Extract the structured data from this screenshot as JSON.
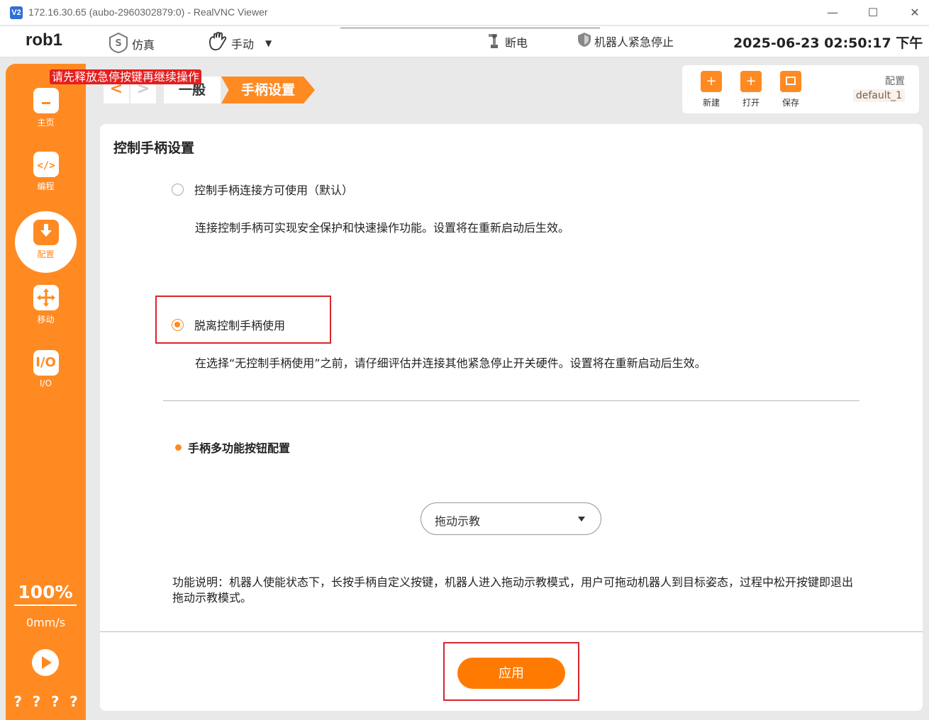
{
  "window": {
    "title": "172.16.30.65 (aubo-2960302879:0) - RealVNC Viewer",
    "app_icon": "V2",
    "controls": {
      "minimize": "—",
      "maximize": "☐",
      "close": "✕"
    }
  },
  "header": {
    "robot_name": "rob1",
    "simulation_label": "仿真",
    "manual_label": "手动",
    "power_off_label": "断电",
    "estop_label": "机器人紧急停止",
    "datetime": "2025-06-23 02:50:17 下午"
  },
  "sidebar": {
    "items": [
      {
        "label": "主页",
        "icon": "home-icon"
      },
      {
        "label": "编程",
        "icon": "code-icon"
      },
      {
        "label": "配置",
        "icon": "config-icon",
        "active": true
      },
      {
        "label": "移动",
        "icon": "move-icon"
      },
      {
        "label": "I/O",
        "icon": "io-icon",
        "glyph": "I/O"
      }
    ],
    "speed_percent": "100%",
    "speed_value": "0mm/s",
    "bottom_marks": [
      "?",
      "?",
      "?",
      "?"
    ]
  },
  "breadcrumb": {
    "back": "<",
    "forward": ">",
    "general": "一般",
    "current": "手柄设置"
  },
  "estop_banner": "请先释放急停按键再继续操作",
  "toolbar": {
    "new_label": "新建",
    "open_label": "打开",
    "save_label": "保存",
    "config_label": "配置",
    "config_value": "default_1"
  },
  "panel": {
    "title": "控制手柄设置",
    "option1_label": "控制手柄连接方可使用（默认）",
    "option1_desc": "连接控制手柄可实现安全保护和快速操作功能。设置将在重新启动后生效。",
    "option2_label": "脱离控制手柄使用",
    "option2_desc": "在选择“无控制手柄使用”之前，请仔细评估并连接其他紧急停止开关硬件。设置将在重新启动后生效。",
    "selected_option": 2,
    "section_title": "手柄多功能按钮配置",
    "dropdown_value": "拖动示教",
    "function_desc": "功能说明：机器人使能状态下，长按手柄自定义按键，机器人进入拖动示教模式，用户可拖动机器人到目标姿态，过程中松开按键即退出拖动示教模式。",
    "apply_label": "应用"
  },
  "colors": {
    "accent": "#ff8a22",
    "apply": "#ff7a00",
    "highlight_box": "#d9252e",
    "banner": "#e61e1e"
  }
}
